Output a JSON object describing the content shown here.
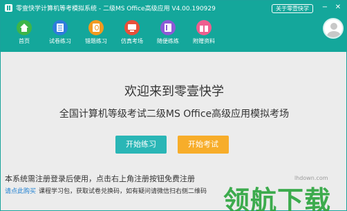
{
  "window": {
    "title": "零壹快学计算机等考模拟系统 - 二级MS Office高级应用 V4.00.190929",
    "about_button": "关于零壹快学",
    "minimize": "−",
    "close": "✕"
  },
  "toolbar": {
    "items": [
      {
        "label": "首页",
        "icon": "home-icon"
      },
      {
        "label": "试卷练习",
        "icon": "paper-icon"
      },
      {
        "label": "错题练习",
        "icon": "wrong-question-icon"
      },
      {
        "label": "仿真考场",
        "icon": "monitor-icon"
      },
      {
        "label": "随便练练",
        "icon": "book-icon"
      },
      {
        "label": "附赠资料",
        "icon": "gift-icon"
      }
    ]
  },
  "main": {
    "welcome": "欢迎来到零壹快学",
    "subtitle": "全国计算机等级考试二级MS Office高级应用模拟考场",
    "practice_button": "开始练习",
    "exam_button": "开始考试",
    "notice": "本系统需注册登录后使用，点击右上角注册按钮免费注册",
    "bottom_link": "请点此购买",
    "bottom_text": "课程学习包，获取试卷兑换码，如有疑问请微信扫右侧二维码"
  },
  "watermark": {
    "text": "领航下载",
    "url": "lhdown.com"
  },
  "colors": {
    "header": "#14a79b",
    "practice_button": "#2ab6b6",
    "exam_button": "#f7ad2a",
    "link": "#1d7fd1"
  }
}
